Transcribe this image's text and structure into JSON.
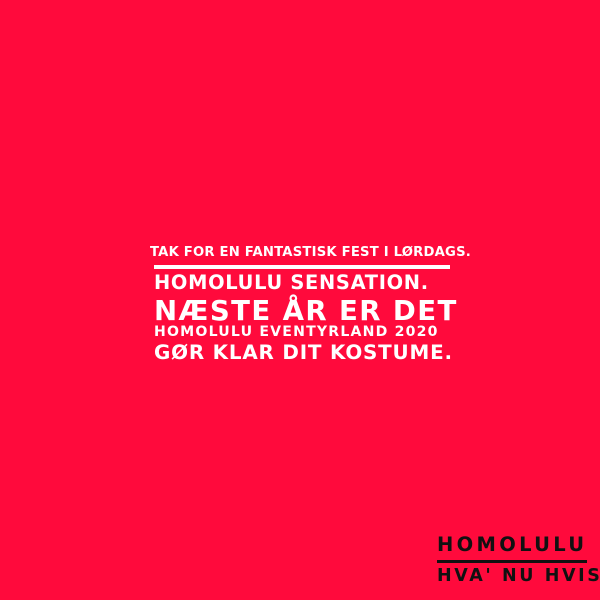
{
  "background_color": "#ff0a3c",
  "text_color": "#ffffff",
  "logo_color": "#111111",
  "message": {
    "line1": "TAK FOR EN FANTASTISK FEST I LØRDAGS.",
    "line2": "HOMOLULU SENSATION.",
    "line3": "NÆSTE ÅR ER DET",
    "line4": "HOMOLULU EVENTYRLAND 2020",
    "line5": "GØR KLAR DIT KOSTUME."
  },
  "logo": {
    "name": "HOMOLULU",
    "tagline": "HVA' NU HVIS"
  }
}
